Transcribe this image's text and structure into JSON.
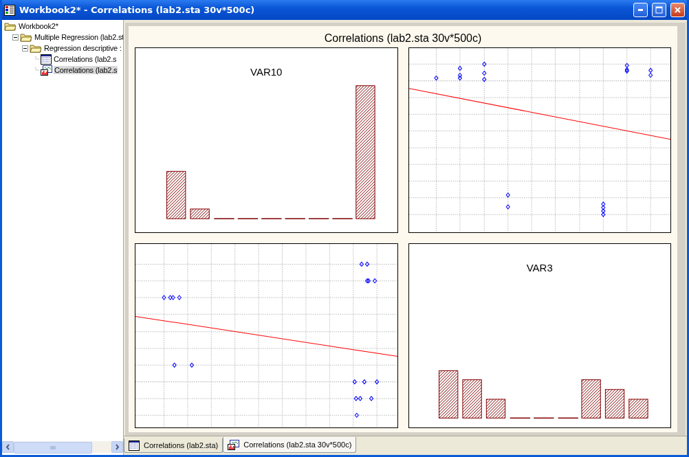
{
  "window": {
    "title": "Workbook2* - Correlations (lab2.sta 30v*500c)"
  },
  "tree": [
    {
      "label": "Workbook2*",
      "kind": "folder",
      "selected": false,
      "children": [
        {
          "label": "Multiple Regression (lab2.st",
          "kind": "folder",
          "expanded": true,
          "selected": false,
          "children": [
            {
              "label": "Regression descriptive :",
              "kind": "folder",
              "expanded": true,
              "selected": false,
              "children": [
                {
                  "label": "Correlations (lab2.s",
                  "kind": "sheet",
                  "selected": false
                },
                {
                  "label": "Correlations (lab2.s",
                  "kind": "graph",
                  "selected": true
                }
              ]
            }
          ]
        }
      ]
    }
  ],
  "graph": {
    "title": "Correlations (lab2.sta 30v*500c)",
    "panels": [
      {
        "kind": "histogram",
        "title": "VAR10"
      },
      {
        "kind": "scatter"
      },
      {
        "kind": "scatter"
      },
      {
        "kind": "histogram",
        "title": "VAR3"
      }
    ]
  },
  "tabs": [
    {
      "label": "Correlations (lab2.sta)",
      "kind": "sheet",
      "selected": false
    },
    {
      "label": "Correlations (lab2.sta 30v*500c)",
      "kind": "graph",
      "selected": true
    }
  ]
}
